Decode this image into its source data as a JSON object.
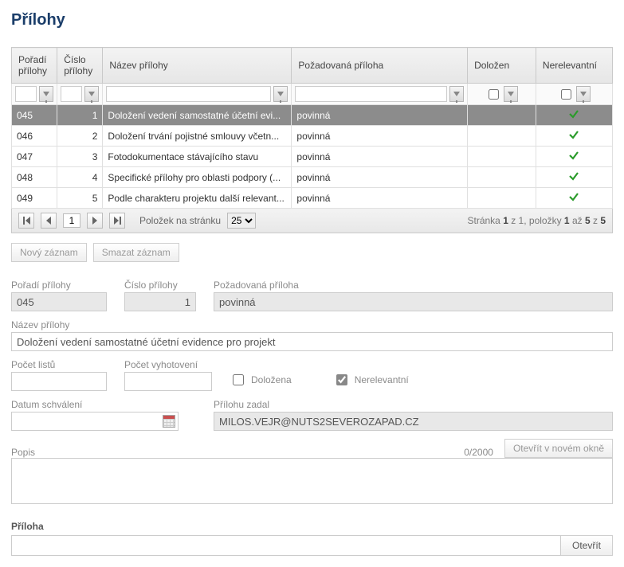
{
  "title": "Přílohy",
  "columns": {
    "poradi": "Pořadí přílohy",
    "cislo": "Číslo přílohy",
    "nazev": "Název přílohy",
    "pozadovana": "Požadovaná příloha",
    "dolozen": "Doložen",
    "nerelevantni": "Nerelevantní"
  },
  "rows": [
    {
      "poradi": "045",
      "cislo": "1",
      "nazev": "Doložení vedení samostatné účetní evi...",
      "pozadovana": "povinná",
      "dolozen": false,
      "nerelevantni": true,
      "selected": true
    },
    {
      "poradi": "046",
      "cislo": "2",
      "nazev": "Doložení trvání pojistné smlouvy včetn...",
      "pozadovana": "povinná",
      "dolozen": false,
      "nerelevantni": true,
      "selected": false
    },
    {
      "poradi": "047",
      "cislo": "3",
      "nazev": "Fotodokumentace stávajícího stavu",
      "pozadovana": "povinná",
      "dolozen": false,
      "nerelevantni": true,
      "selected": false
    },
    {
      "poradi": "048",
      "cislo": "4",
      "nazev": "Specifické přílohy pro oblasti podpory (...",
      "pozadovana": "povinná",
      "dolozen": false,
      "nerelevantni": true,
      "selected": false
    },
    {
      "poradi": "049",
      "cislo": "5",
      "nazev": "Podle charakteru projektu další relevant...",
      "pozadovana": "povinná",
      "dolozen": false,
      "nerelevantni": true,
      "selected": false
    }
  ],
  "pager": {
    "page": "1",
    "pagesize_label": "Položek na stránku",
    "pagesize": "25",
    "status_prefix": "Stránka ",
    "status_page": "1",
    "status_mid1": " z 1, položky ",
    "status_from": "1",
    "status_mid2": " až ",
    "status_to": "5",
    "status_mid3": " z ",
    "status_total": "5"
  },
  "buttons": {
    "novy": "Nový záznam",
    "smazat": "Smazat záznam",
    "otevrit_okno": "Otevřít v novém okně",
    "otevrit": "Otevřít"
  },
  "form": {
    "labels": {
      "poradi": "Pořadí přílohy",
      "cislo": "Číslo přílohy",
      "pozadovana": "Požadovaná příloha",
      "nazev": "Název přílohy",
      "pocet_listu": "Počet listů",
      "pocet_vyhotoveni": "Počet vyhotovení",
      "dolozena": "Doložena",
      "nerelevantni": "Nerelevantní",
      "datum": "Datum schválení",
      "zadal": "Přílohu zadal",
      "popis": "Popis",
      "priloha": "Příloha"
    },
    "values": {
      "poradi": "045",
      "cislo": "1",
      "pozadovana": "povinná",
      "nazev": "Doložení vedení samostatné účetní evidence pro projekt",
      "pocet_listu": "",
      "pocet_vyhotoveni": "",
      "dolozena_checked": false,
      "nerelevantni_checked": true,
      "datum": "",
      "zadal": "MILOS.VEJR@NUTS2SEVEROZAPAD.CZ",
      "popis": "",
      "popis_counter": "0/2000",
      "priloha": ""
    }
  }
}
